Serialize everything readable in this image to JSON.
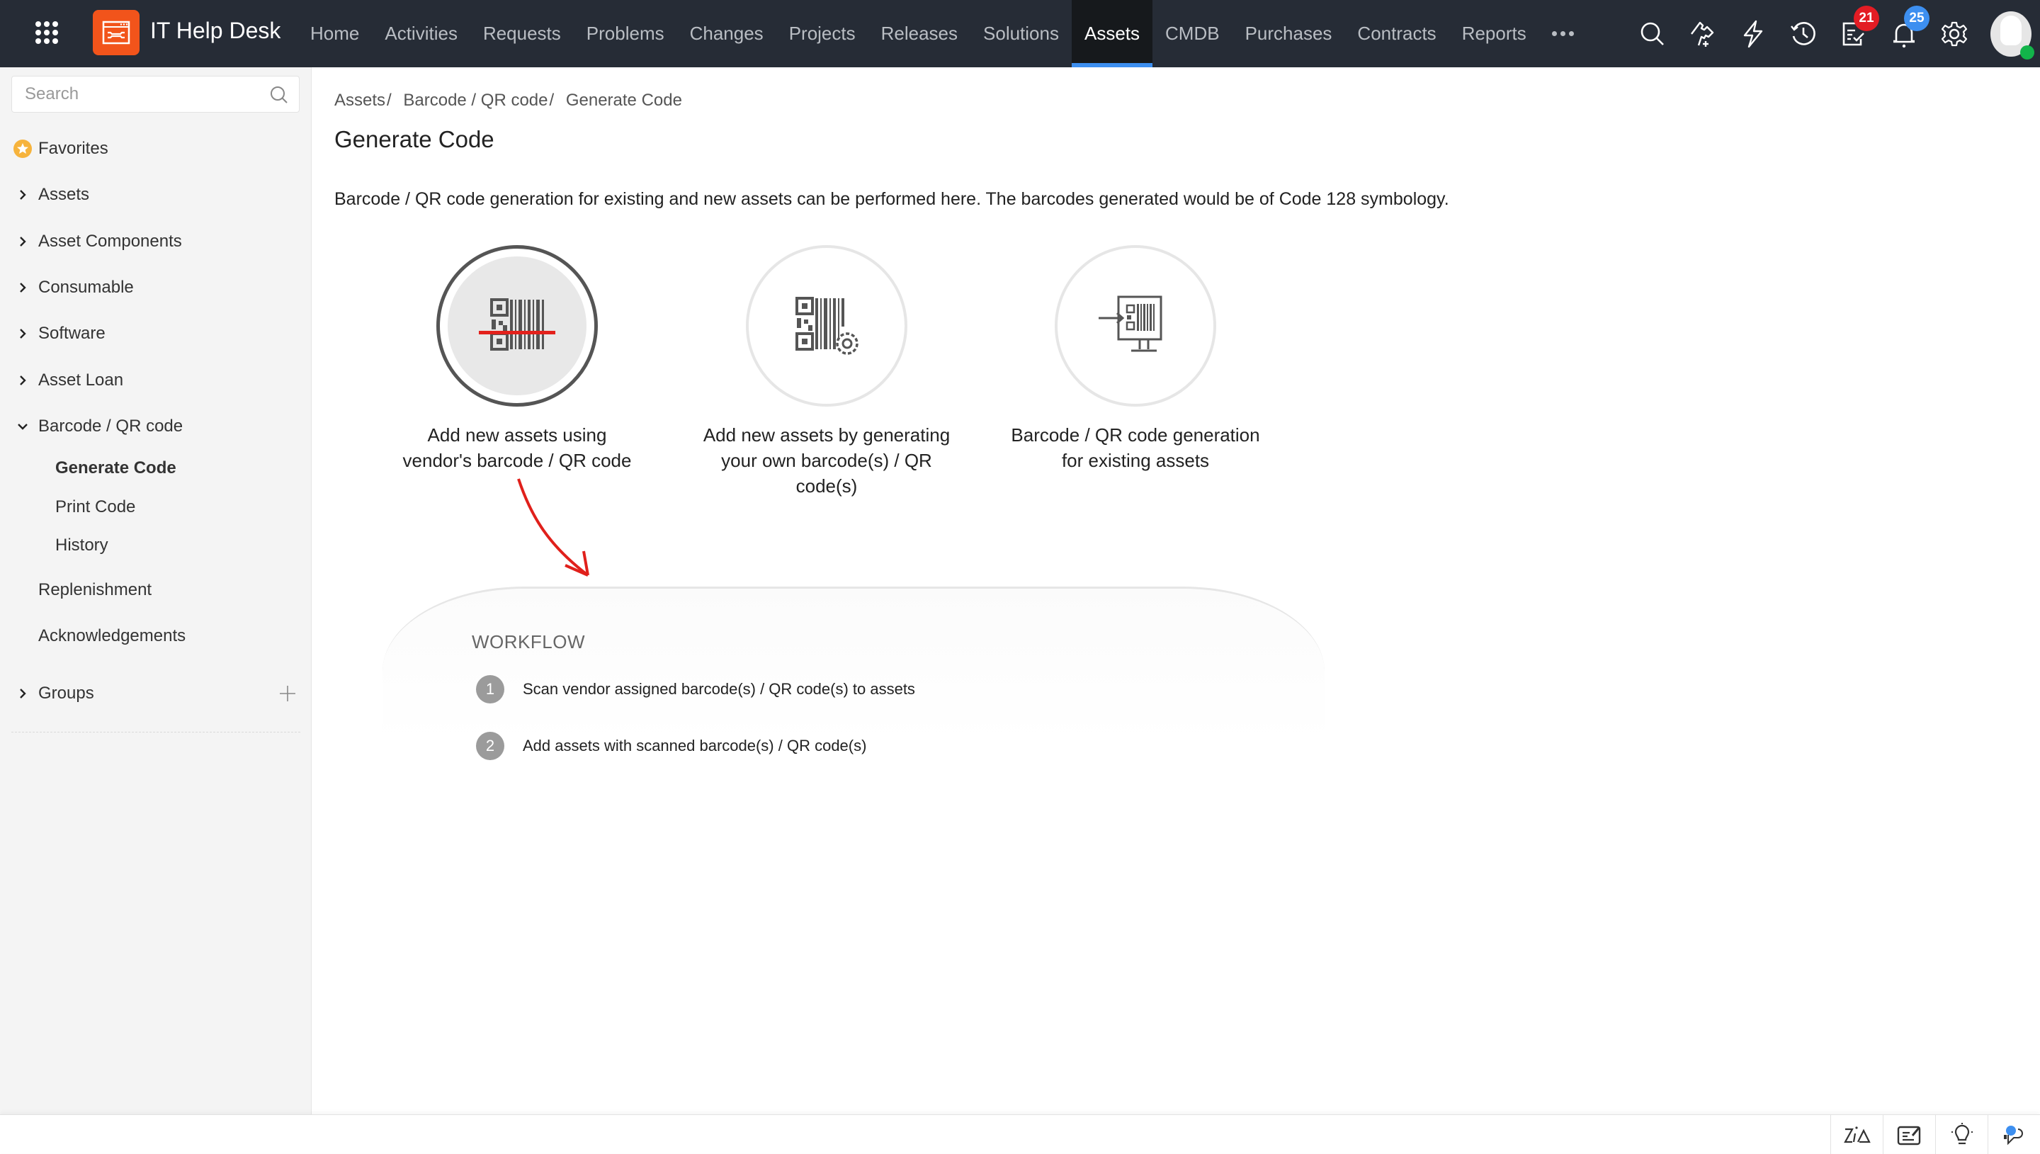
{
  "header": {
    "app_title": "IT Help Desk",
    "nav": [
      {
        "label": "Home",
        "active": false
      },
      {
        "label": "Activities",
        "active": false
      },
      {
        "label": "Requests",
        "active": false
      },
      {
        "label": "Problems",
        "active": false
      },
      {
        "label": "Changes",
        "active": false
      },
      {
        "label": "Projects",
        "active": false
      },
      {
        "label": "Releases",
        "active": false
      },
      {
        "label": "Solutions",
        "active": false
      },
      {
        "label": "Assets",
        "active": true
      },
      {
        "label": "CMDB",
        "active": false
      },
      {
        "label": "Purchases",
        "active": false
      },
      {
        "label": "Contracts",
        "active": false
      },
      {
        "label": "Reports",
        "active": false
      }
    ],
    "icons": [
      "search-icon",
      "add-ticket-icon",
      "quick-actions-icon",
      "history-icon",
      "tasks-icon",
      "notifications-icon",
      "settings-icon"
    ],
    "tasks_badge": "21",
    "notifications_badge": "25",
    "colors": {
      "bar": "#262c36",
      "active_tab": "#16191c",
      "active_underline": "#3d8ff0",
      "logo": "#f2541b",
      "badge_red": "#e31c24",
      "badge_blue": "#3d8ff0",
      "online": "#12b44a"
    }
  },
  "sidebar": {
    "search_placeholder": "Search",
    "favorites": "Favorites",
    "items": [
      {
        "label": "Assets"
      },
      {
        "label": "Asset Components"
      },
      {
        "label": "Consumable"
      },
      {
        "label": "Software"
      },
      {
        "label": "Asset Loan"
      },
      {
        "label": "Barcode / QR code",
        "expanded": true
      }
    ],
    "sub_items": [
      {
        "label": "Generate Code",
        "active": true
      },
      {
        "label": "Print Code",
        "active": false
      },
      {
        "label": "History",
        "active": false
      }
    ],
    "replenishment": "Replenishment",
    "acknowledgements": "Acknowledgements",
    "groups": "Groups"
  },
  "main": {
    "breadcrumb": [
      {
        "label": "Assets"
      },
      {
        "label": "Barcode / QR code"
      },
      {
        "label": "Generate Code"
      }
    ],
    "breadcrumb_sep": "/",
    "title": "Generate Code",
    "description": "Barcode / QR code generation for existing and new assets can be performed here. The barcodes generated would be of Code 128 symbology.",
    "options": [
      {
        "line1": "Add new assets using",
        "line2": "vendor's barcode / QR code",
        "line3": "",
        "selected": true,
        "icon": "barcode-scan-icon"
      },
      {
        "line1": "Add new assets by generating",
        "line2": "your own barcode(s) / QR",
        "line3": "code(s)",
        "selected": false,
        "icon": "barcode-generate-icon"
      },
      {
        "line1": "Barcode / QR code generation",
        "line2": "for existing assets",
        "line3": "",
        "selected": false,
        "icon": "barcode-existing-icon"
      }
    ],
    "workflow": {
      "title": "WORKFLOW",
      "steps": [
        {
          "num": "1",
          "text": "Scan vendor assigned barcode(s) / QR code(s) to assets"
        },
        {
          "num": "2",
          "text": "Add assets with scanned barcode(s) / QR code(s)"
        }
      ]
    }
  },
  "footer": {
    "icons": [
      "zia-icon",
      "notes-icon",
      "tips-icon",
      "chat-icon"
    ]
  }
}
